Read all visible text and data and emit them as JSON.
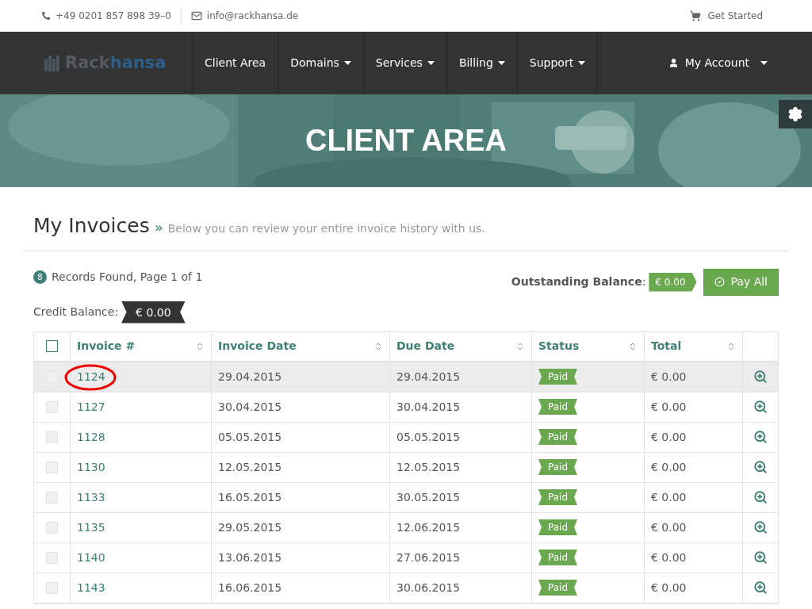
{
  "top_bar": {
    "phone": "+49 0201 857 898 39–0",
    "email": "info@rackhansa.de",
    "get_started": "Get Started"
  },
  "nav": {
    "logo_part_1": "Rack",
    "logo_part_2": "hansa",
    "items": [
      {
        "label": "Client Area",
        "dropdown": false
      },
      {
        "label": "Domains",
        "dropdown": true
      },
      {
        "label": "Services",
        "dropdown": true
      },
      {
        "label": "Billing",
        "dropdown": true
      },
      {
        "label": "Support",
        "dropdown": true
      }
    ],
    "account": {
      "label": "My Account",
      "dropdown": true
    }
  },
  "hero": {
    "title": "CLIENT AREA"
  },
  "page": {
    "title": "My Invoices",
    "separator": "»",
    "subtitle": "Below you can review your entire invoice history with us."
  },
  "summary": {
    "count": "8",
    "records": "Records Found, Page 1 of 1",
    "outstanding_label": "Outstanding Balance",
    "outstanding_colon": ":",
    "outstanding_value": "€ 0.00",
    "pay_all": "Pay All",
    "credit_label": "Credit Balance:",
    "credit_value": "€ 0.00"
  },
  "table": {
    "select_all_checked": false,
    "columns": [
      "Invoice #",
      "Invoice Date",
      "Due Date",
      "Status",
      "Total"
    ],
    "rows": [
      {
        "invoice": "1124",
        "invoice_date": "29.04.2015",
        "due_date": "29.04.2015",
        "status": "Paid",
        "total": "€ 0.00",
        "checked": false,
        "highlighted": true,
        "circled": true
      },
      {
        "invoice": "1127",
        "invoice_date": "30.04.2015",
        "due_date": "30.04.2015",
        "status": "Paid",
        "total": "€ 0.00",
        "checked": false,
        "highlighted": false,
        "circled": false
      },
      {
        "invoice": "1128",
        "invoice_date": "05.05.2015",
        "due_date": "05.05.2015",
        "status": "Paid",
        "total": "€ 0.00",
        "checked": false,
        "highlighted": false,
        "circled": false
      },
      {
        "invoice": "1130",
        "invoice_date": "12.05.2015",
        "due_date": "12.05.2015",
        "status": "Paid",
        "total": "€ 0.00",
        "checked": false,
        "highlighted": false,
        "circled": false
      },
      {
        "invoice": "1133",
        "invoice_date": "16.05.2015",
        "due_date": "30.05.2015",
        "status": "Paid",
        "total": "€ 0.00",
        "checked": false,
        "highlighted": false,
        "circled": false
      },
      {
        "invoice": "1135",
        "invoice_date": "29.05.2015",
        "due_date": "12.06.2015",
        "status": "Paid",
        "total": "€ 0.00",
        "checked": false,
        "highlighted": false,
        "circled": false
      },
      {
        "invoice": "1140",
        "invoice_date": "13.06.2015",
        "due_date": "27.06.2015",
        "status": "Paid",
        "total": "€ 0.00",
        "checked": false,
        "highlighted": false,
        "circled": false
      },
      {
        "invoice": "1143",
        "invoice_date": "16.06.2015",
        "due_date": "30.06.2015",
        "status": "Paid",
        "total": "€ 0.00",
        "checked": false,
        "highlighted": false,
        "circled": false
      }
    ]
  }
}
